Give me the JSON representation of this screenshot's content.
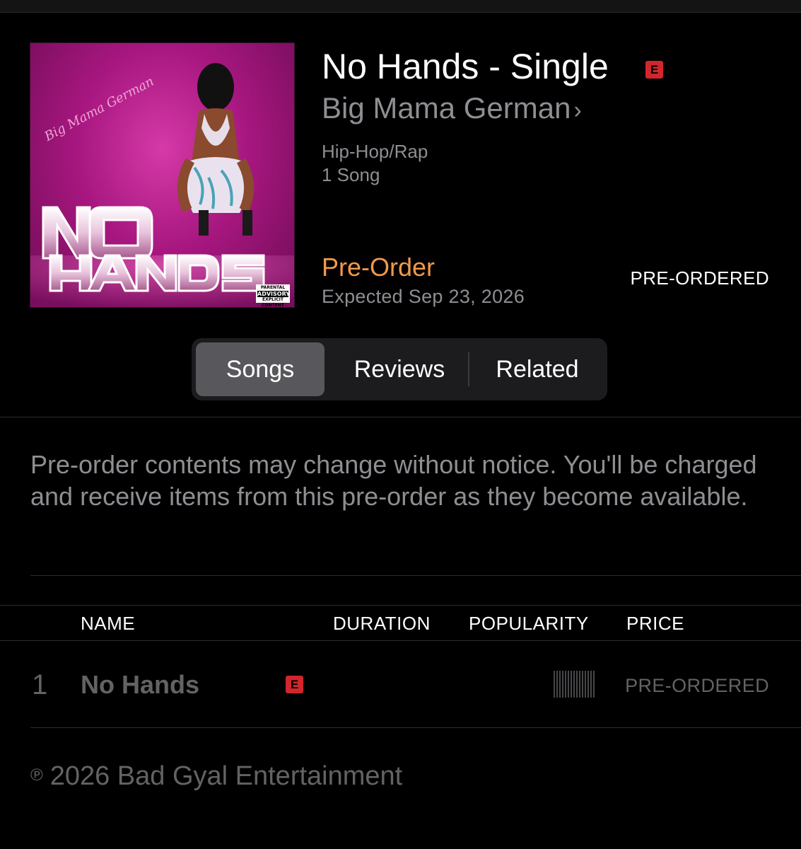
{
  "album": {
    "title": "No Hands - Single",
    "explicit_badge": "E",
    "artist": "Big Mama German",
    "artist_chevron": "›",
    "genre": "Hip-Hop/Rap",
    "song_count": "1 Song",
    "preorder_label": "Pre-Order",
    "expected": "Expected Sep 23, 2026",
    "status": "PRE-ORDERED",
    "artwork": {
      "script_text": "Big Mama German",
      "title_line1": "NO",
      "title_line2": "HANDS",
      "advisory_top": "PARENTAL",
      "advisory_main": "ADVISORY",
      "advisory_bottom": "EXPLICIT CONTENT"
    }
  },
  "tabs": {
    "songs": "Songs",
    "reviews": "Reviews",
    "related": "Related",
    "active": "Songs"
  },
  "notice": "Pre-order contents may change without notice. You'll be charged and receive items from this pre-order as they become available.",
  "table": {
    "headers": {
      "name": "NAME",
      "duration": "DURATION",
      "popularity": "POPULARITY",
      "price": "PRICE"
    },
    "rows": [
      {
        "number": "1",
        "name": "No Hands",
        "explicit": "E",
        "duration": "",
        "price": "PRE-ORDERED"
      }
    ]
  },
  "copyright": {
    "symbol": "℗",
    "text": "2026 Bad Gyal Entertainment"
  },
  "colors": {
    "background": "#000000",
    "accent_orange": "#f2994a",
    "secondary_text": "#8e8e93",
    "explicit_red": "#d1262c",
    "segment_active": "#58585c"
  }
}
